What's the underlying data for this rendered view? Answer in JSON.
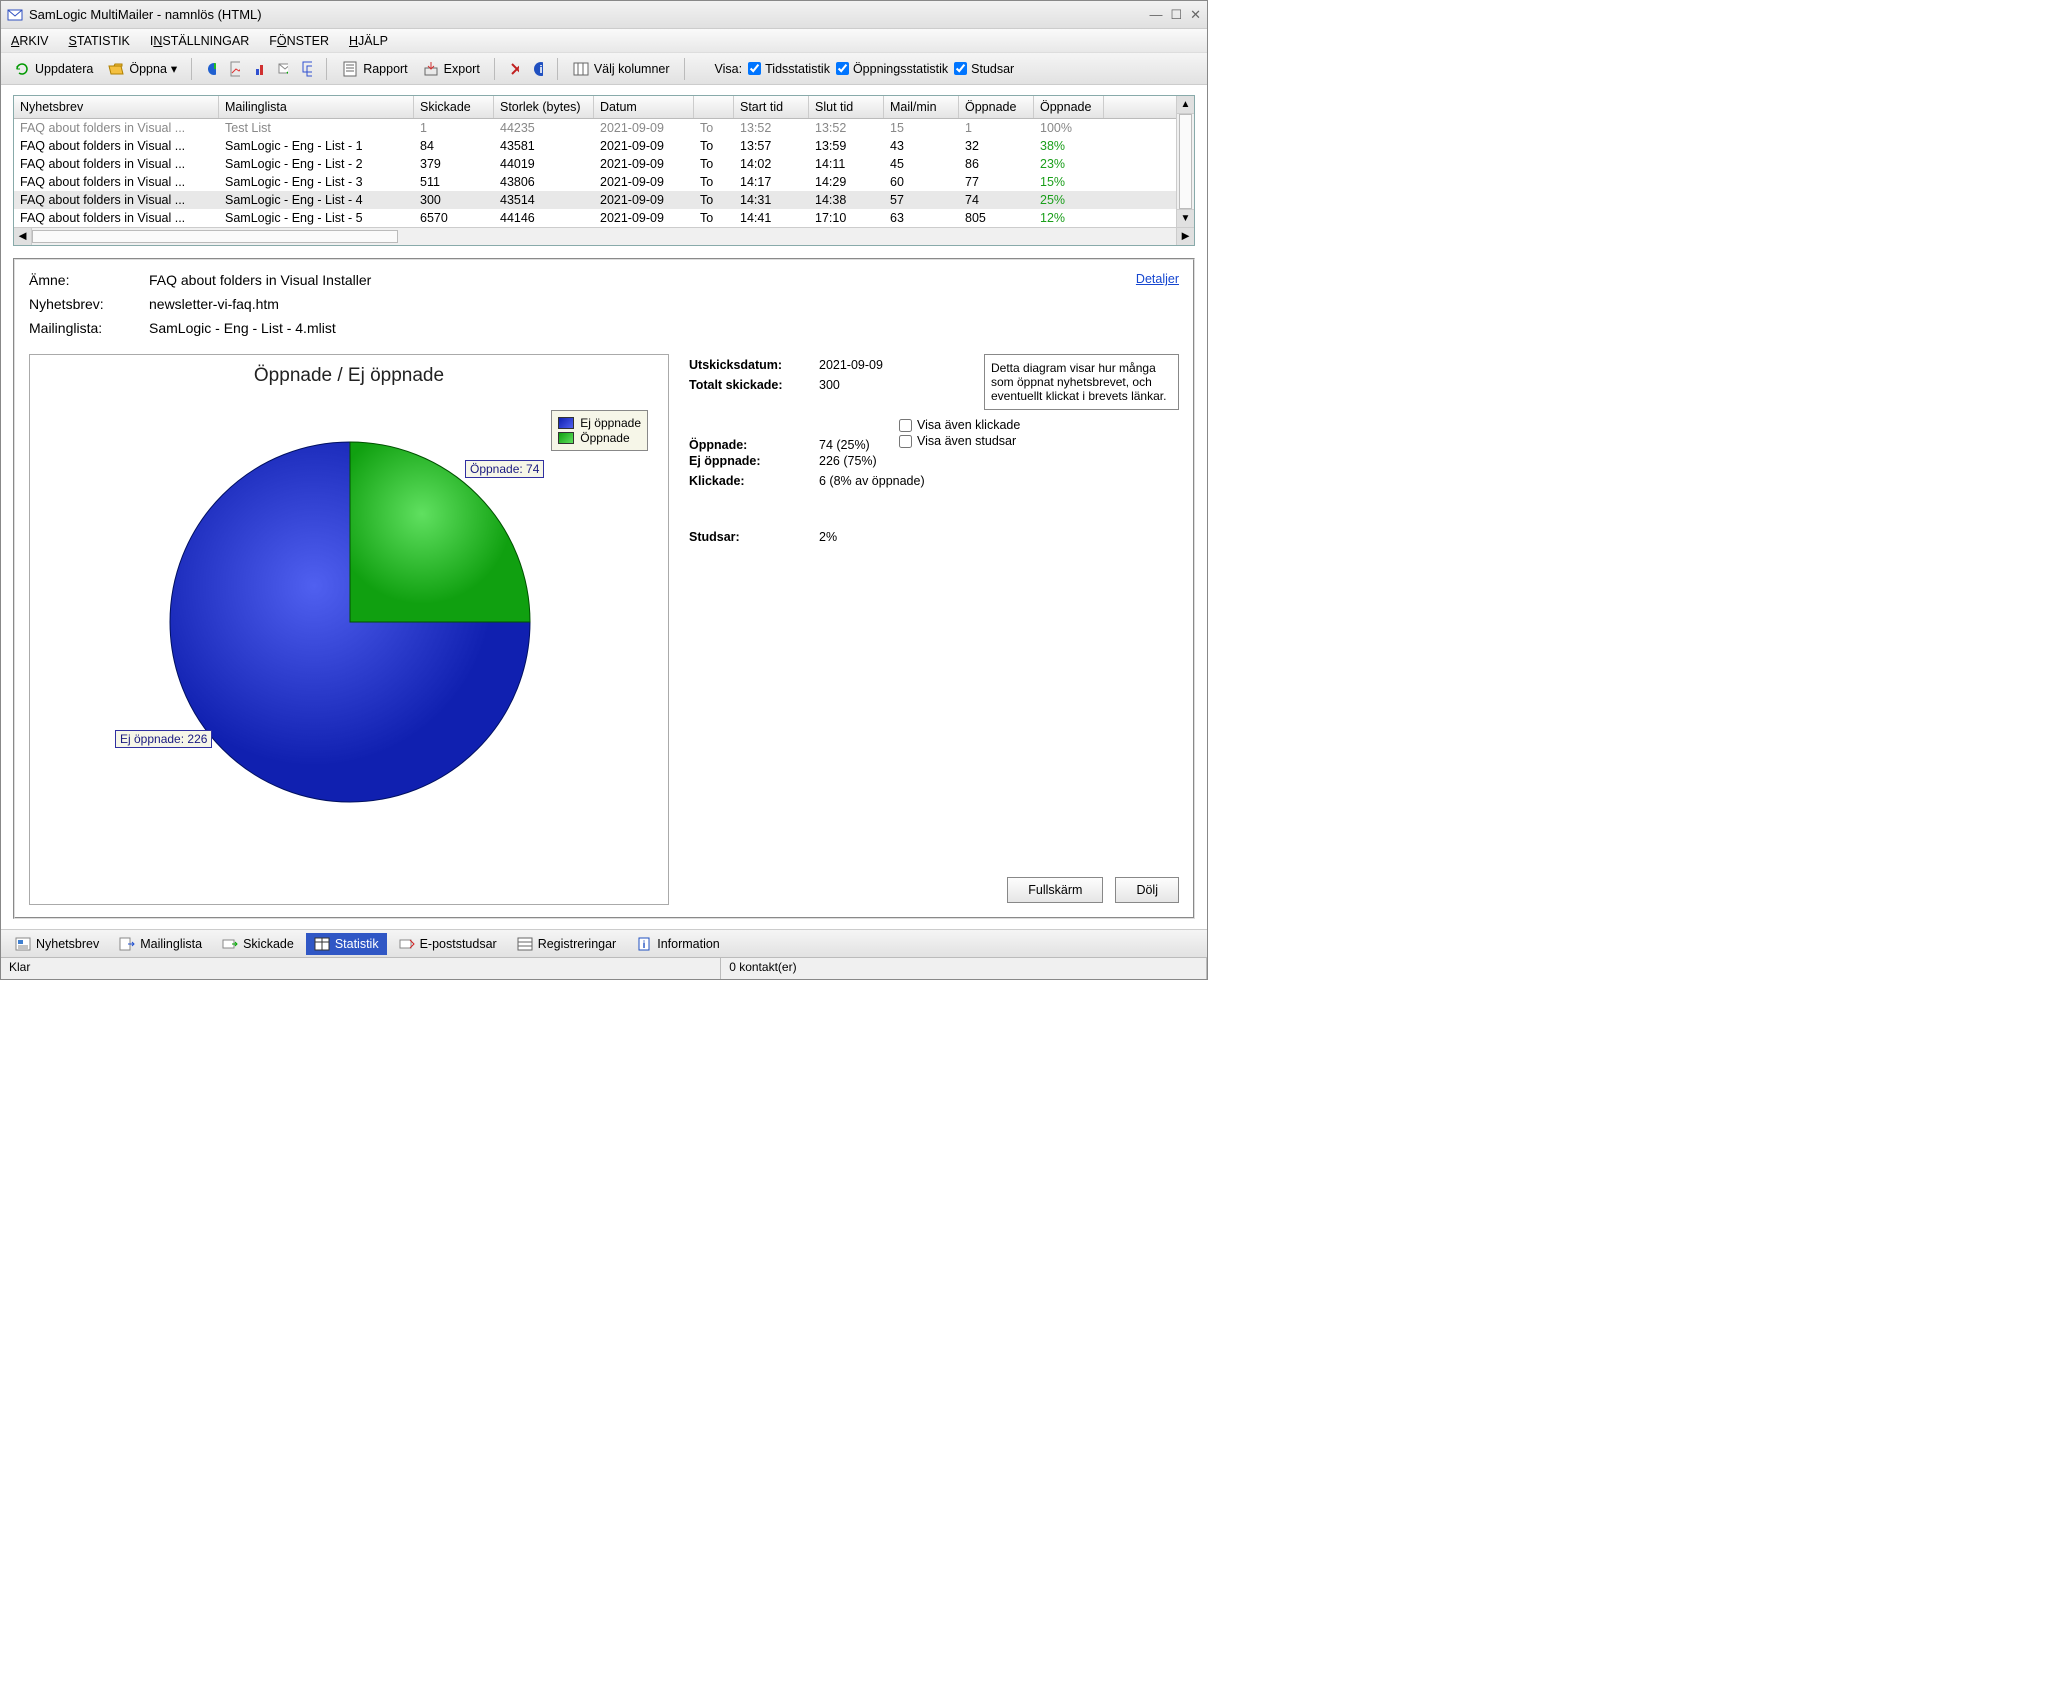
{
  "window": {
    "title": "SamLogic MultiMailer - namnlös  (HTML)"
  },
  "menu": {
    "arkiv": "ARKIV",
    "statistik": "STATISTIK",
    "installningar": "INSTÄLLNINGAR",
    "fonster": "FÖNSTER",
    "hjalp": "HJÄLP"
  },
  "toolbar": {
    "uppdatera": "Uppdatera",
    "oppna": "Öppna",
    "rapport": "Rapport",
    "export": "Export",
    "valjkolumner": "Välj kolumner",
    "visa": "Visa:",
    "tidsstatistik": "Tidsstatistik",
    "oppningsstatistik": "Öppningsstatistik",
    "studsar": "Studsar"
  },
  "grid": {
    "headers": {
      "nyhetsbrev": "Nyhetsbrev",
      "mailinglista": "Mailinglista",
      "skickade": "Skickade",
      "storlek": "Storlek (bytes)",
      "datum": "Datum",
      "blank": "",
      "starttid": "Start tid",
      "sluttid": "Slut tid",
      "mailmin": "Mail/min",
      "oppnade": "Öppnade",
      "oppnadepct": "Öppnade"
    },
    "rows": [
      {
        "dim": true,
        "n": "FAQ about folders in Visual ...",
        "m": "Test List",
        "s": "1",
        "st": "44235",
        "d": "2021-09-09",
        "t": "To",
        "a": "13:52",
        "b": "13:52",
        "mm": "15",
        "o": "1",
        "op": "100%"
      },
      {
        "n": "FAQ about folders in Visual ...",
        "m": "SamLogic - Eng - List - 1",
        "s": "84",
        "st": "43581",
        "d": "2021-09-09",
        "t": "To",
        "a": "13:57",
        "b": "13:59",
        "mm": "43",
        "o": "32",
        "op": "38%"
      },
      {
        "n": "FAQ about folders in Visual ...",
        "m": "SamLogic - Eng - List - 2",
        "s": "379",
        "st": "44019",
        "d": "2021-09-09",
        "t": "To",
        "a": "14:02",
        "b": "14:11",
        "mm": "45",
        "o": "86",
        "op": "23%"
      },
      {
        "n": "FAQ about folders in Visual ...",
        "m": "SamLogic - Eng - List - 3",
        "s": "511",
        "st": "43806",
        "d": "2021-09-09",
        "t": "To",
        "a": "14:17",
        "b": "14:29",
        "mm": "60",
        "o": "77",
        "op": "15%"
      },
      {
        "sel": true,
        "n": "FAQ about folders in Visual ...",
        "m": "SamLogic - Eng - List - 4",
        "s": "300",
        "st": "43514",
        "d": "2021-09-09",
        "t": "To",
        "a": "14:31",
        "b": "14:38",
        "mm": "57",
        "o": "74",
        "op": "25%"
      },
      {
        "n": "FAQ about folders in Visual ...",
        "m": "SamLogic - Eng - List - 5",
        "s": "6570",
        "st": "44146",
        "d": "2021-09-09",
        "t": "To",
        "a": "14:41",
        "b": "17:10",
        "mm": "63",
        "o": "805",
        "op": "12%"
      }
    ]
  },
  "detail": {
    "amne_label": "Ämne:",
    "amne_value": "FAQ about folders in Visual Installer",
    "nyhet_label": "Nyhetsbrev:",
    "nyhet_value": "newsletter-vi-faq.htm",
    "ml_label": "Mailinglista:",
    "ml_value": "SamLogic - Eng - List - 4.mlist",
    "detaljer": "Detaljer"
  },
  "chart": {
    "title": "Öppnade / Ej öppnade",
    "legend_ej": "Ej öppnade",
    "legend_opp": "Öppnade",
    "label_opp": "Öppnade: 74",
    "label_ej": "Ej öppnade: 226"
  },
  "chart_data": {
    "type": "pie",
    "title": "Öppnade / Ej öppnade",
    "categories": [
      "Ej öppnade",
      "Öppnade"
    ],
    "values": [
      226,
      74
    ],
    "colors": [
      "#2030d0",
      "#20c020"
    ]
  },
  "stats": {
    "utdatum_l": "Utskicksdatum:",
    "utdatum_v": "2021-09-09",
    "totalt_l": "Totalt skickade:",
    "totalt_v": "300",
    "opp_l": "Öppnade:",
    "opp_v": "74  (25%)",
    "ej_l": "Ej öppnade:",
    "ej_v": "226  (75%)",
    "klick_l": "Klickade:",
    "klick_v": "6  (8% av öppnade)",
    "studs_l": "Studsar:",
    "studs_v": "2%",
    "help": "Detta diagram visar hur många som öppnat nyhetsbrevet, och eventuellt klickat i brevets länkar.",
    "visa_klick": "Visa även klickade",
    "visa_studs": "Visa även studsar",
    "fullskarm": "Fullskärm",
    "dolj": "Dölj"
  },
  "bottomtabs": {
    "nyhetsbrev": "Nyhetsbrev",
    "mailinglista": "Mailinglista",
    "skickade": "Skickade",
    "statistik": "Statistik",
    "epoststudsar": "E-poststudsar",
    "registreringar": "Registreringar",
    "information": "Information"
  },
  "statusbar": {
    "klar": "Klar",
    "kontakt": "0 kontakt(er)"
  }
}
